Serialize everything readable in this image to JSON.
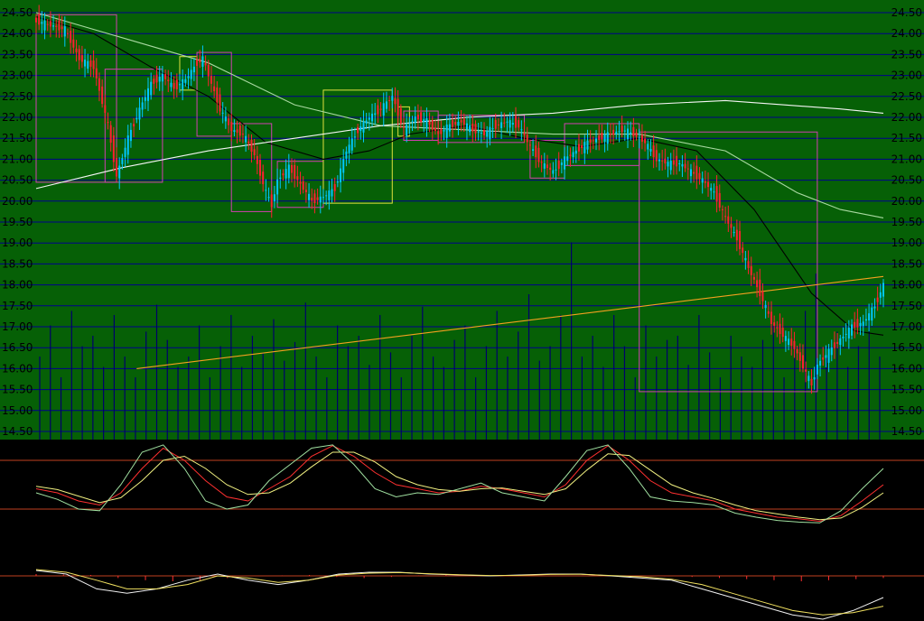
{
  "colors": {
    "main_bg": "#066006",
    "sub_bg": "#000000",
    "grid": "#00008b",
    "up": "#00c8ff",
    "down": "#ff2030",
    "ma_short": "#000000",
    "ma_mid": "#a8d8a0",
    "ma_long": "#f4f4f4",
    "trend": "#f4a020",
    "box_up": "#e0e040",
    "box_down": "#d040b0",
    "volume": "#00006a",
    "osc_ref": "#c04020",
    "osc_k": "#ff3030",
    "osc_d": "#f0f080",
    "osc_j": "#a0e0a0",
    "macd_bar": "#ff3030",
    "macd_dif": "#f0f0f0",
    "macd_dea": "#f0e060"
  },
  "chart_data": [
    {
      "type": "candlestick",
      "y_axis": {
        "ticks": [
          "24.50",
          "24.00",
          "23.50",
          "23.00",
          "22.50",
          "22.00",
          "21.50",
          "21.00",
          "20.50",
          "20.00",
          "19.50",
          "19.00",
          "18.50",
          "18.00",
          "17.50",
          "17.00",
          "16.50",
          "16.00",
          "15.50",
          "15.00",
          "14.50"
        ],
        "ylim": [
          14.5,
          24.5
        ]
      },
      "close_points": [
        [
          0,
          24.3
        ],
        [
          5,
          24.2
        ],
        [
          10,
          24.1
        ],
        [
          15,
          23.4
        ],
        [
          20,
          23.2
        ],
        [
          25,
          21.8
        ],
        [
          28,
          20.6
        ],
        [
          32,
          21.5
        ],
        [
          36,
          22.2
        ],
        [
          40,
          22.8
        ],
        [
          44,
          23.0
        ],
        [
          48,
          22.7
        ],
        [
          52,
          22.9
        ],
        [
          56,
          23.3
        ],
        [
          58,
          23.4
        ],
        [
          60,
          23.0
        ],
        [
          64,
          22.2
        ],
        [
          68,
          21.7
        ],
        [
          72,
          21.6
        ],
        [
          76,
          21.1
        ],
        [
          80,
          20.2
        ],
        [
          82,
          19.9
        ],
        [
          84,
          20.5
        ],
        [
          88,
          20.8
        ],
        [
          92,
          20.4
        ],
        [
          96,
          20.0
        ],
        [
          100,
          20.1
        ],
        [
          104,
          20.3
        ],
        [
          108,
          21.2
        ],
        [
          112,
          21.7
        ],
        [
          116,
          22.0
        ],
        [
          120,
          22.2
        ],
        [
          124,
          22.5
        ],
        [
          126,
          22.1
        ],
        [
          128,
          21.7
        ],
        [
          132,
          22.0
        ],
        [
          136,
          21.9
        ],
        [
          140,
          21.6
        ],
        [
          144,
          21.8
        ],
        [
          148,
          21.9
        ],
        [
          152,
          21.7
        ],
        [
          156,
          21.6
        ],
        [
          160,
          21.8
        ],
        [
          164,
          21.9
        ],
        [
          168,
          21.8
        ],
        [
          172,
          21.3
        ],
        [
          176,
          20.9
        ],
        [
          180,
          20.7
        ],
        [
          184,
          21.0
        ],
        [
          188,
          21.2
        ],
        [
          192,
          21.4
        ],
        [
          196,
          21.5
        ],
        [
          200,
          21.6
        ],
        [
          204,
          21.7
        ],
        [
          208,
          21.6
        ],
        [
          212,
          21.4
        ],
        [
          216,
          21.0
        ],
        [
          220,
          20.9
        ],
        [
          224,
          20.9
        ],
        [
          228,
          20.7
        ],
        [
          232,
          20.5
        ],
        [
          236,
          20.2
        ],
        [
          240,
          19.6
        ],
        [
          244,
          19.1
        ],
        [
          248,
          18.4
        ],
        [
          252,
          17.8
        ],
        [
          256,
          17.1
        ],
        [
          260,
          16.8
        ],
        [
          264,
          16.5
        ],
        [
          268,
          15.9
        ],
        [
          270,
          15.6
        ],
        [
          272,
          16.1
        ],
        [
          276,
          16.4
        ],
        [
          280,
          16.7
        ],
        [
          284,
          17.0
        ],
        [
          288,
          17.1
        ],
        [
          292,
          17.5
        ],
        [
          295,
          18.0
        ]
      ],
      "moving_averages": [
        {
          "role": "short",
          "points": [
            [
              0,
              24.4
            ],
            [
              20,
              24.0
            ],
            [
              40,
              23.2
            ],
            [
              60,
              22.5
            ],
            [
              80,
              21.4
            ],
            [
              100,
              21.0
            ],
            [
              116,
              21.2
            ],
            [
              130,
              21.6
            ],
            [
              150,
              21.8
            ],
            [
              170,
              21.5
            ],
            [
              190,
              21.3
            ],
            [
              210,
              21.5
            ],
            [
              230,
              21.2
            ],
            [
              250,
              19.8
            ],
            [
              270,
              17.8
            ],
            [
              285,
              16.9
            ],
            [
              295,
              16.8
            ]
          ]
        },
        {
          "role": "mid",
          "points": [
            [
              0,
              24.5
            ],
            [
              30,
              23.9
            ],
            [
              60,
              23.3
            ],
            [
              90,
              22.3
            ],
            [
              120,
              21.8
            ],
            [
              150,
              21.7
            ],
            [
              180,
              21.6
            ],
            [
              210,
              21.6
            ],
            [
              240,
              21.2
            ],
            [
              265,
              20.2
            ],
            [
              280,
              19.8
            ],
            [
              295,
              19.6
            ]
          ]
        },
        {
          "role": "long",
          "points": [
            [
              0,
              20.3
            ],
            [
              30,
              20.8
            ],
            [
              60,
              21.2
            ],
            [
              90,
              21.5
            ],
            [
              120,
              21.8
            ],
            [
              150,
              22.0
            ],
            [
              180,
              22.1
            ],
            [
              210,
              22.3
            ],
            [
              240,
              22.4
            ],
            [
              260,
              22.3
            ],
            [
              280,
              22.2
            ],
            [
              295,
              22.1
            ]
          ]
        },
        {
          "role": "trend",
          "points": [
            [
              35,
              16.0
            ],
            [
              295,
              18.2
            ]
          ]
        }
      ],
      "volume_rel": [
        0.4,
        0.55,
        0.3,
        0.62,
        0.45,
        0.5,
        0.35,
        0.6,
        0.4,
        0.3,
        0.52,
        0.65,
        0.48,
        0.35,
        0.4,
        0.55,
        0.3,
        0.45,
        0.6,
        0.35,
        0.5,
        0.42,
        0.58,
        0.38,
        0.47,
        0.66,
        0.4,
        0.3,
        0.55,
        0.45,
        0.5,
        0.36,
        0.6,
        0.42,
        0.3,
        0.5,
        0.64,
        0.4,
        0.35,
        0.48,
        0.55,
        0.3,
        0.45,
        0.62,
        0.4,
        0.52,
        0.7,
        0.38,
        0.45,
        0.6,
        0.95,
        0.4,
        0.5,
        0.35,
        0.6,
        0.45,
        0.3,
        0.55,
        0.4,
        0.48,
        0.5,
        0.36,
        0.6,
        0.42,
        0.3,
        0.5,
        0.4,
        0.35,
        0.48,
        0.55,
        0.3,
        0.45,
        0.62,
        0.8,
        0.4,
        0.52,
        0.35,
        0.45,
        0.6,
        0.4
      ]
    },
    {
      "type": "line",
      "role": "oscillator",
      "reference_levels": [
        80,
        20
      ],
      "ylim": [
        0,
        100
      ],
      "series": [
        {
          "role": "K",
          "values": [
            45,
            40,
            30,
            25,
            40,
            70,
            95,
            80,
            55,
            35,
            30,
            45,
            60,
            85,
            98,
            85,
            65,
            50,
            45,
            40,
            42,
            48,
            45,
            40,
            35,
            50,
            80,
            98,
            80,
            55,
            40,
            35,
            30,
            20,
            15,
            10,
            8,
            5,
            12,
            30,
            50
          ]
        },
        {
          "role": "D",
          "values": [
            48,
            44,
            36,
            28,
            34,
            55,
            80,
            85,
            70,
            50,
            38,
            40,
            52,
            72,
            90,
            90,
            78,
            60,
            50,
            44,
            42,
            45,
            46,
            42,
            38,
            45,
            68,
            88,
            86,
            68,
            50,
            40,
            33,
            25,
            18,
            14,
            10,
            7,
            9,
            22,
            40
          ]
        },
        {
          "role": "J",
          "values": [
            40,
            32,
            20,
            18,
            50,
            90,
            99,
            70,
            30,
            20,
            25,
            55,
            75,
            95,
            99,
            75,
            45,
            35,
            40,
            38,
            45,
            52,
            40,
            35,
            30,
            60,
            92,
            99,
            70,
            35,
            30,
            28,
            25,
            15,
            10,
            6,
            4,
            3,
            18,
            45,
            70
          ]
        }
      ]
    },
    {
      "type": "line",
      "role": "macd",
      "ylim": [
        -1,
        1
      ],
      "series": [
        {
          "role": "DIF",
          "values": [
            0.3,
            0.1,
            -0.3,
            -0.4,
            -0.3,
            -0.1,
            0.1,
            -0.1,
            -0.2,
            -0.1,
            0.1,
            0.2,
            0.2,
            0.1,
            0.05,
            0.0,
            0.05,
            0.1,
            0.1,
            0.0,
            -0.05,
            -0.1,
            -0.3,
            -0.5,
            -0.7,
            -0.9,
            -1.0,
            -0.8,
            -0.5
          ]
        },
        {
          "role": "DEA",
          "values": [
            0.35,
            0.2,
            -0.1,
            -0.3,
            -0.3,
            -0.2,
            0.0,
            -0.05,
            -0.15,
            -0.1,
            0.05,
            0.15,
            0.18,
            0.12,
            0.06,
            0.02,
            0.03,
            0.08,
            0.09,
            0.02,
            -0.02,
            -0.08,
            -0.2,
            -0.4,
            -0.6,
            -0.8,
            -0.9,
            -0.85,
            -0.7
          ]
        }
      ],
      "histogram": [
        0.2,
        0.15,
        0.1,
        -0.1,
        -0.2,
        -0.25,
        -0.2,
        -0.1,
        0.0,
        0.05,
        0.1,
        -0.05,
        -0.1,
        -0.05,
        0.05,
        0.1,
        0.1,
        0.05,
        0.0,
        0.02,
        0.03,
        0.02,
        0.0,
        -0.02,
        -0.05,
        -0.1,
        -0.15,
        -0.2,
        -0.25,
        -0.2,
        -0.15,
        -0.1
      ]
    }
  ]
}
